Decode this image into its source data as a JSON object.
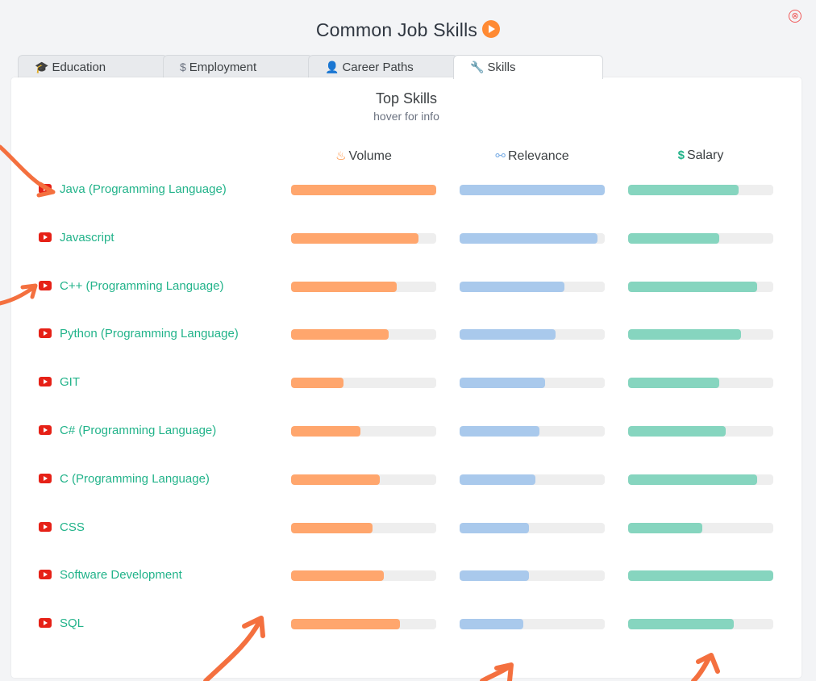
{
  "modal": {
    "title": "Common Job Skills",
    "close_label": "⊗"
  },
  "tabs": [
    {
      "label": "Education",
      "icon": "graduation-cap-icon",
      "glyph": "🎓",
      "active": false
    },
    {
      "label": "Employment",
      "icon": "dollar-icon",
      "glyph": "$",
      "active": false
    },
    {
      "label": "Career Paths",
      "icon": "person-icon",
      "glyph": "👤",
      "active": false
    },
    {
      "label": "Skills",
      "icon": "wrench-icon",
      "glyph": "🔧",
      "active": true
    }
  ],
  "panel": {
    "title": "Top Skills",
    "subtitle": "hover for info"
  },
  "columns": [
    {
      "label": "Volume",
      "icon": "flame-icon",
      "glyph": "🔥",
      "color": "#ffa66d"
    },
    {
      "label": "Relevance",
      "icon": "network-icon",
      "glyph": "⚯",
      "color": "#a9c9ec"
    },
    {
      "label": "Salary",
      "icon": "dollar-icon",
      "glyph": "$",
      "color": "#22b38a"
    }
  ],
  "skills": [
    {
      "name": "Java (Programming Language)",
      "volume": 1.0,
      "relevance": 1.0,
      "salary": 0.76
    },
    {
      "name": "Javascript",
      "volume": 0.88,
      "relevance": 0.95,
      "salary": 0.63
    },
    {
      "name": "C++ (Programming Language)",
      "volume": 0.73,
      "relevance": 0.72,
      "salary": 0.89
    },
    {
      "name": "Python (Programming Language)",
      "volume": 0.67,
      "relevance": 0.66,
      "salary": 0.78
    },
    {
      "name": "GIT",
      "volume": 0.36,
      "relevance": 0.59,
      "salary": 0.63
    },
    {
      "name": "C# (Programming Language)",
      "volume": 0.48,
      "relevance": 0.55,
      "salary": 0.67
    },
    {
      "name": "C (Programming Language)",
      "volume": 0.61,
      "relevance": 0.52,
      "salary": 0.89
    },
    {
      "name": "CSS",
      "volume": 0.56,
      "relevance": 0.48,
      "salary": 0.51
    },
    {
      "name": "Software Development",
      "volume": 0.64,
      "relevance": 0.48,
      "salary": 1.0
    },
    {
      "name": "SQL",
      "volume": 0.75,
      "relevance": 0.44,
      "salary": 0.73
    }
  ],
  "annotation_color": "#f4703f"
}
